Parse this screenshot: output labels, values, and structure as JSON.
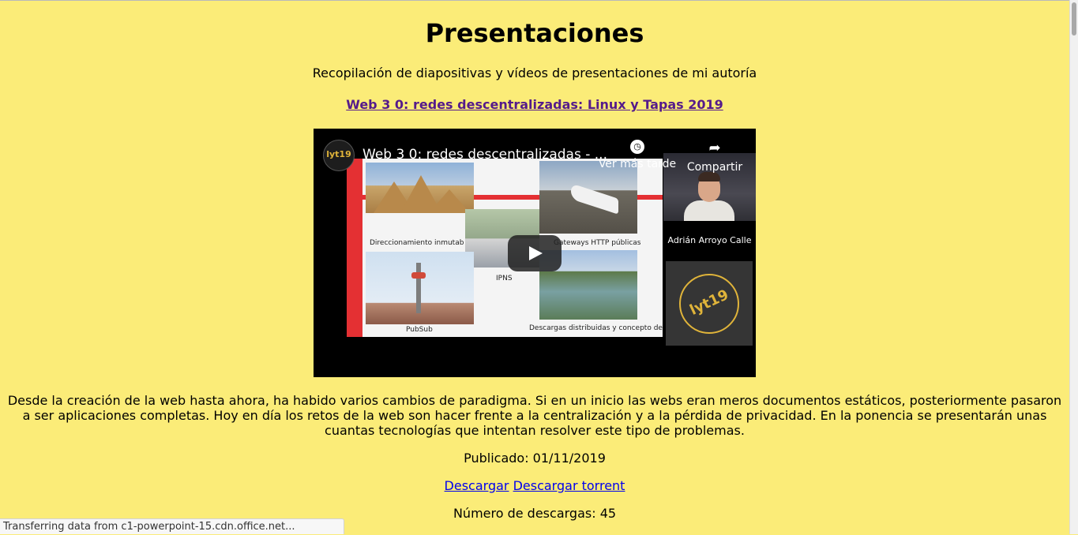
{
  "page": {
    "title": "Presentaciones",
    "subtitle": "Recopilación de diapositivas y vídeos de presentaciones de mi autoría"
  },
  "presentation": {
    "link_title": "Web 3 0: redes descentralizadas: Linux y Tapas 2019",
    "video": {
      "title": "Web 3 0: redes descentralizadas - ...",
      "channel_logo_text": "lyt19",
      "watch_later_label": "Ver más tarde",
      "share_label": "Compartir",
      "presenter_name": "Adrián Arroyo Calle",
      "logo_text": "lyt19",
      "slide_captions": {
        "addressing": "Direccionamiento inmutab",
        "gateways": "Gateways HTTP públicas",
        "ipns": "IPNS",
        "pubsub": "PubSub",
        "downloads": "Descargas distribuidas y concepto de"
      }
    },
    "description": "Desde la creación de la web hasta ahora, ha habido varios cambios de paradigma. Si en un inicio las webs eran meros documentos estáticos, posteriormente pasaron a ser aplicaciones completas. Hoy en día los retos de la web son hacer frente a la centralización y a la pérdida de privacidad. En la ponencia se presentarán unas cuantas tecnologías que intentan resolver este tipo de problemas.",
    "published": "Publicado: 01/11/2019",
    "download_label": "Descargar",
    "download_torrent_label": "Descargar torrent",
    "download_count": "Número de descargas: 45"
  },
  "status_bar": {
    "text": "Transferring data from c1-powerpoint-15.cdn.office.net..."
  },
  "colors": {
    "background": "#fbec78",
    "visited_link": "#551a8b",
    "link": "#0000ee",
    "accent_gold": "#e0b43a"
  }
}
